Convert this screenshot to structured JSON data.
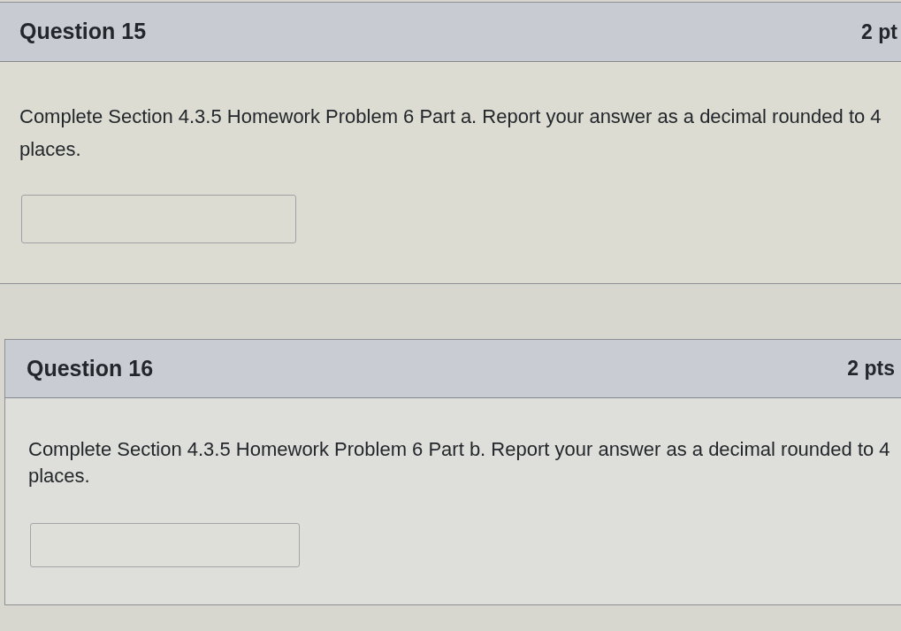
{
  "questions": [
    {
      "title": "Question 15",
      "points": "2 pt",
      "text": "Complete Section 4.3.5 Homework Problem 6 Part a. Report your answer as a decimal rounded to 4 places."
    },
    {
      "title": "Question 16",
      "points": "2 pts",
      "text": "Complete Section 4.3.5 Homework Problem 6 Part b. Report your answer as a decimal rounded to 4 places."
    }
  ]
}
